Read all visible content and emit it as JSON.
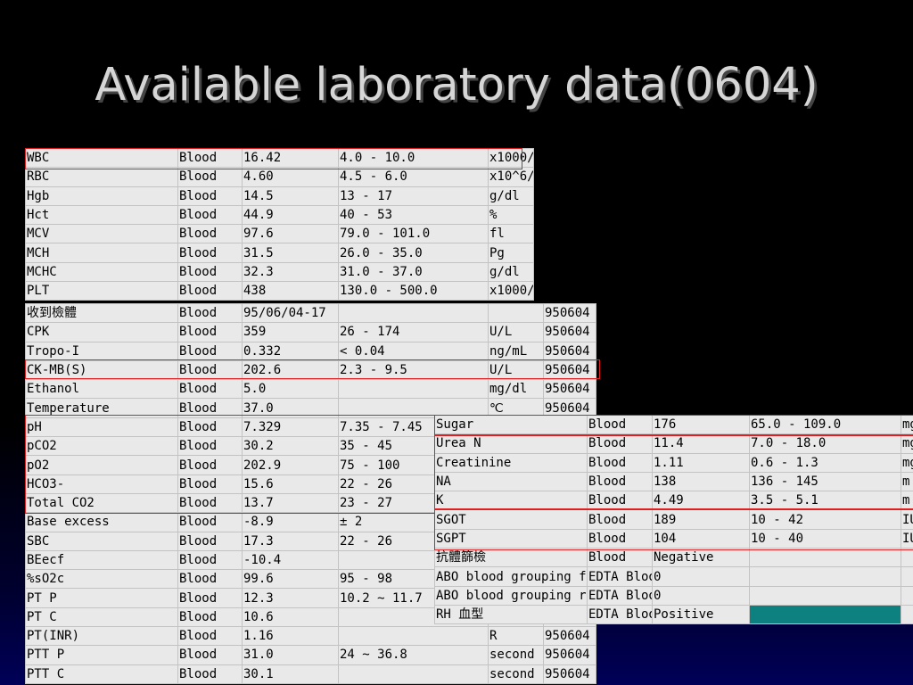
{
  "title": "Available laboratory data(0604)",
  "cbc_table": {
    "rows": [
      [
        "WBC",
        "Blood",
        "16.42",
        " 4.0 - 10.0",
        "x1000/"
      ],
      [
        "RBC",
        "Blood",
        "4.60",
        " 4.5 - 6.0",
        "x10^6/"
      ],
      [
        "Hgb",
        "Blood",
        "14.5",
        " 13 - 17",
        "g/dl"
      ],
      [
        "Hct",
        "Blood",
        "44.9",
        "40 - 53",
        "%"
      ],
      [
        "MCV",
        "Blood",
        "97.6",
        " 79.0 - 101.0",
        "fl"
      ],
      [
        "MCH",
        "Blood",
        "31.5",
        " 26.0 - 35.0",
        "Pg"
      ],
      [
        "MCHC",
        "Blood",
        "32.3",
        " 31.0 - 37.0",
        "g/dl"
      ],
      [
        "PLT",
        "Blood",
        "438",
        " 130.0 - 500.0",
        "x1000/"
      ]
    ]
  },
  "chem_table": {
    "rows": [
      [
        "收到檢體",
        "Blood",
        "95/06/04-17",
        "",
        "",
        "950604"
      ],
      [
        "CPK",
        "Blood",
        "359",
        " 26 - 174",
        "U/L",
        "950604"
      ],
      [
        "Tropo-I",
        "Blood",
        "0.332",
        " < 0.04",
        "ng/mL",
        "950604"
      ],
      [
        "CK-MB(S)",
        "Blood",
        "202.6",
        " 2.3 - 9.5",
        "U/L",
        "950604"
      ],
      [
        "Ethanol",
        "Blood",
        "5.0",
        "",
        "mg/dl",
        "950604"
      ],
      [
        "Temperature",
        "Blood",
        "37.0",
        "",
        "℃",
        "950604"
      ],
      [
        "pH",
        "Blood",
        "7.329",
        " 7.35 - 7.45",
        "",
        ""
      ],
      [
        "pCO2",
        "Blood",
        "30.2",
        " 35 - 45",
        "",
        ""
      ],
      [
        "pO2",
        "Blood",
        "202.9",
        " 75 - 100",
        "",
        ""
      ],
      [
        "HCO3-",
        "Blood",
        "15.6",
        " 22 - 26",
        "",
        ""
      ],
      [
        "Total CO2",
        "Blood",
        "13.7",
        " 23 - 27",
        "",
        ""
      ],
      [
        "Base excess",
        "Blood",
        "-8.9",
        " ± 2",
        "",
        ""
      ],
      [
        "SBC",
        "Blood",
        "17.3",
        " 22 - 26",
        "",
        ""
      ],
      [
        "BEecf",
        "Blood",
        "-10.4",
        "",
        "",
        ""
      ],
      [
        "%sO2c",
        "Blood",
        "99.6",
        " 95 - 98",
        "",
        ""
      ],
      [
        "PT P",
        "Blood",
        "12.3",
        " 10.2 ~ 11.7",
        "",
        ""
      ],
      [
        "PT C",
        "Blood",
        "10.6",
        "",
        "",
        ""
      ],
      [
        "PT(INR)",
        "Blood",
        "1.16",
        "",
        "R",
        "950604"
      ],
      [
        "PTT P",
        "Blood",
        "31.0",
        " 24 ~ 36.8",
        "second",
        "950604"
      ],
      [
        "PTT C",
        "Blood",
        "30.1",
        "",
        "second",
        "950604"
      ]
    ]
  },
  "right_table": {
    "rows": [
      [
        "Sugar",
        "Blood",
        "176",
        " 65.0 - 109.0",
        "mg."
      ],
      [
        "Urea N",
        "Blood",
        "11.4",
        " 7.0 - 18.0",
        "mg."
      ],
      [
        "Creatinine",
        "Blood",
        "1.11",
        " 0.6 - 1.3",
        "mg."
      ],
      [
        "NA",
        "Blood",
        "138",
        " 136 - 145",
        "m m"
      ],
      [
        "K",
        "Blood",
        "4.49",
        " 3.5 - 5.1",
        "m m"
      ],
      [
        "SGOT",
        "Blood",
        "189",
        " 10 - 42",
        "IU."
      ],
      [
        "SGPT",
        "Blood",
        "104",
        " 10 - 40",
        "IU."
      ],
      [
        "抗體篩檢",
        "Blood",
        "Negative",
        "",
        ""
      ],
      [
        "ABO blood grouping f",
        "EDTA Blood",
        "0",
        "",
        ""
      ],
      [
        "ABO blood grouping r",
        "EDTA Blood",
        "0",
        "",
        ""
      ],
      [
        "RH 血型",
        "EDTA Blood",
        "Positive",
        "",
        ""
      ]
    ]
  },
  "colors": {
    "highlight": "#e02020",
    "cell_bg": "#e9e9e9",
    "teal_cell": "#0d8080"
  }
}
